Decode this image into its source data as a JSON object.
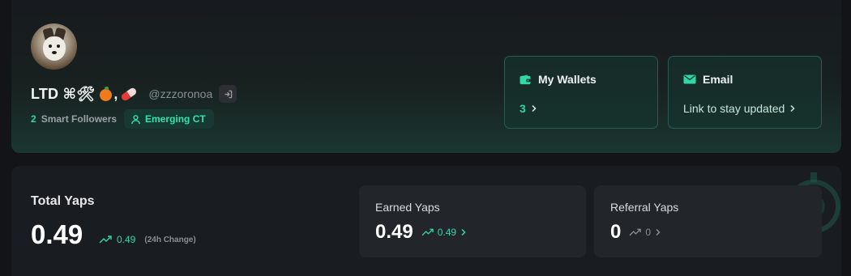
{
  "profile": {
    "display_name": "LTD ⌘🛠",
    "comma": ",",
    "handle": "@zzzoronoa",
    "smart_followers_count": "2",
    "smart_followers_label": "Smart Followers",
    "tier_label": "Emerging CT",
    "avatar_icon": "husky-avatar"
  },
  "cards": {
    "wallets": {
      "title": "My Wallets",
      "value": "3",
      "icon": "wallet-icon"
    },
    "email": {
      "title": "Email",
      "link": "Link to stay updated",
      "icon": "mail-icon"
    }
  },
  "yaps": {
    "total": {
      "title": "Total Yaps",
      "value": "0.49",
      "change": "0.49",
      "change_note": "(24h Change)"
    },
    "earned": {
      "title": "Earned Yaps",
      "value": "0.49",
      "change": "0.49"
    },
    "referral": {
      "title": "Referral Yaps",
      "value": "0",
      "change": "0"
    }
  },
  "colors": {
    "accent": "#2fd7a9",
    "background": "#121417",
    "card": "#22262b"
  }
}
